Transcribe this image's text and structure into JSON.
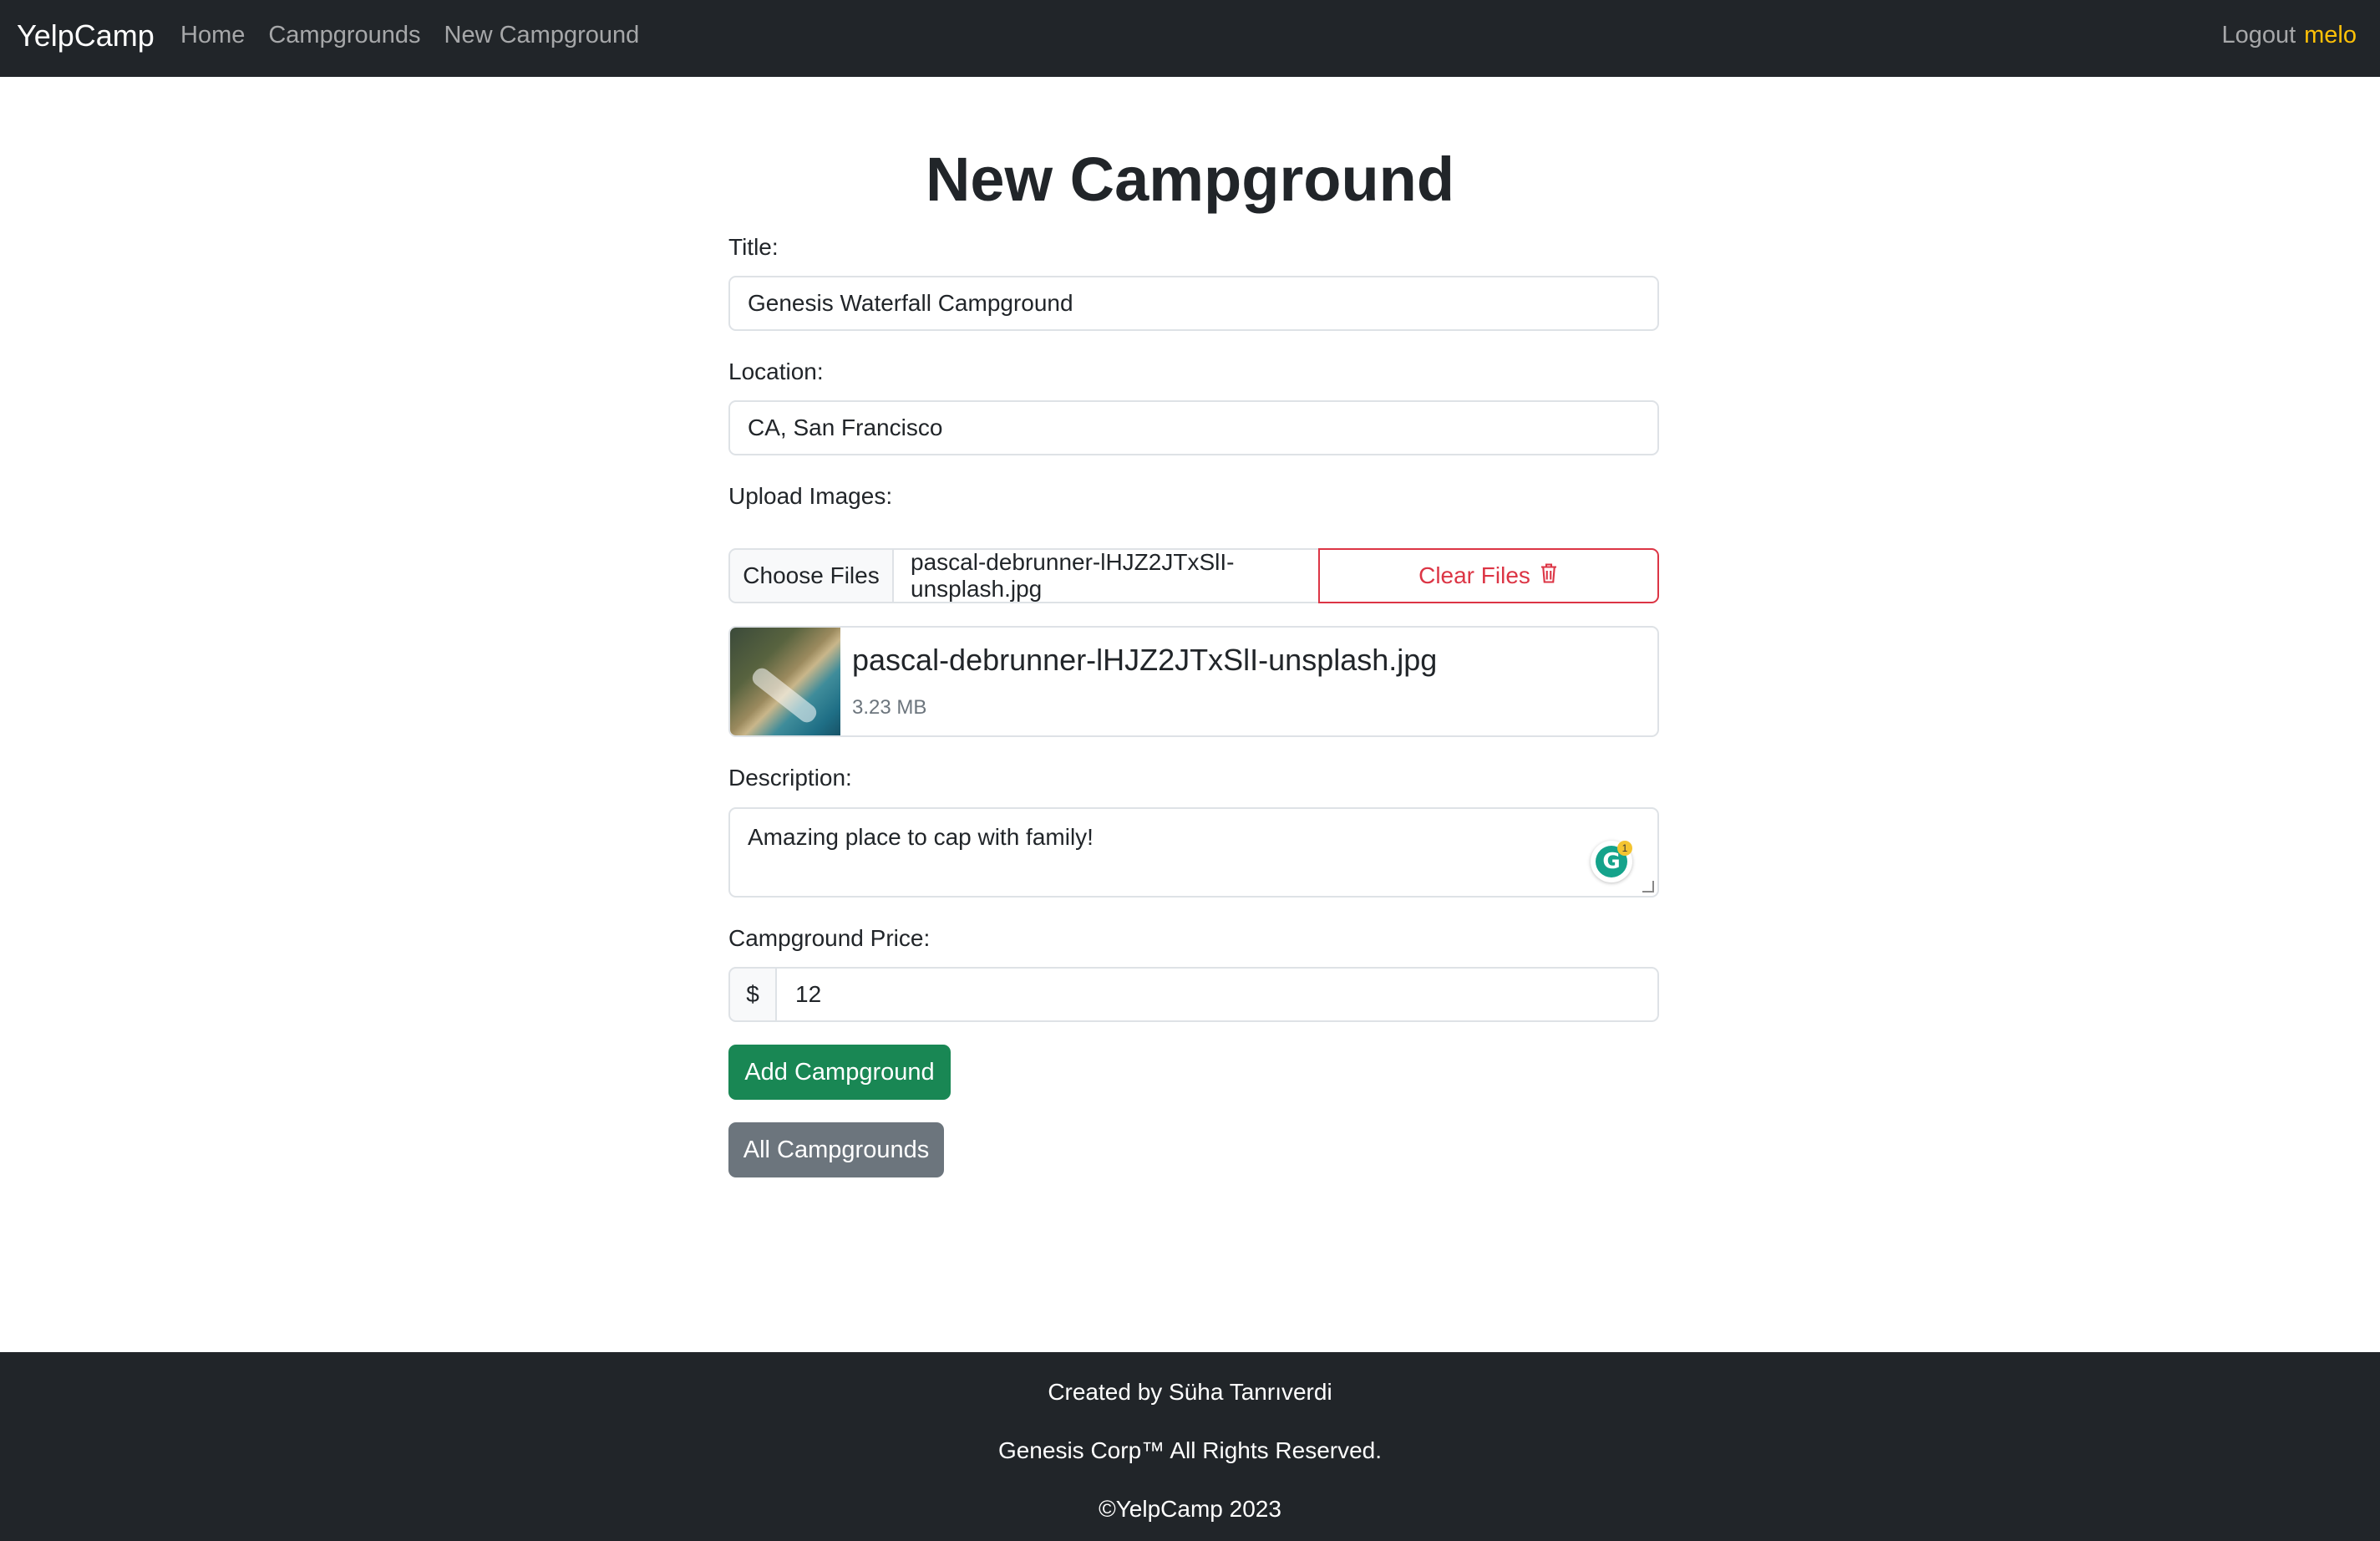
{
  "navbar": {
    "brand": "YelpCamp",
    "links": [
      "Home",
      "Campgrounds",
      "New Campground"
    ],
    "logout": "Logout",
    "username": "melo"
  },
  "form": {
    "heading": "New Campground",
    "title_label": "Title:",
    "title_value": "Genesis Waterfall Campground",
    "location_label": "Location:",
    "location_value": "CA, San Francisco",
    "upload_label": "Upload Images:",
    "choose_files_label": "Choose Files",
    "selected_file": "pascal-debrunner-lHJZ2JTxSlI-unsplash.jpg",
    "clear_files_label": "Clear Files",
    "preview": {
      "file_name": "pascal-debrunner-lHJZ2JTxSlI-unsplash.jpg",
      "file_size": "3.23 MB"
    },
    "description_label": "Description:",
    "description_value": "Amazing place to cap with family!",
    "grammarly_badge_count": "1",
    "price_label": "Campground Price:",
    "currency_symbol": "$",
    "price_value": "12",
    "submit_label": "Add Campground",
    "all_campgrounds_label": "All Campgrounds"
  },
  "footer": {
    "created_by": "Created by Süha Tanrıverdi",
    "rights": "Genesis Corp™ All Rights Reserved.",
    "copyright": "©YelpCamp 2023"
  },
  "colors": {
    "navbar_bg": "#212529",
    "username": "#ffc107",
    "success": "#198754",
    "secondary": "#6c757d",
    "danger": "#dc3545"
  }
}
